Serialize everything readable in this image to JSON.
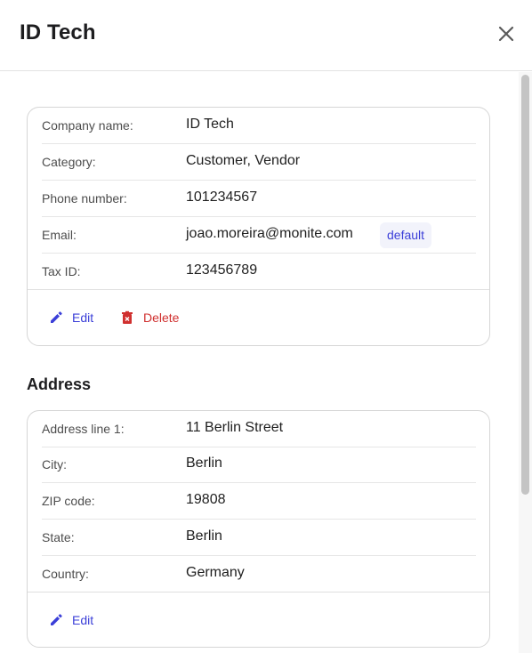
{
  "header": {
    "title": "ID Tech",
    "close_icon": "close-icon"
  },
  "company_card": {
    "fields": [
      {
        "label": "Company name:",
        "value": "ID Tech"
      },
      {
        "label": "Category:",
        "value": "Customer, Vendor"
      },
      {
        "label": "Phone number:",
        "value": "101234567"
      },
      {
        "label": "Email:",
        "value": "joao.moreira@monite.com",
        "badge": "default"
      },
      {
        "label": "Tax ID:",
        "value": "123456789"
      }
    ],
    "edit_label": "Edit",
    "delete_label": "Delete"
  },
  "address_section": {
    "title": "Address",
    "fields": [
      {
        "label": "Address line 1:",
        "value": "11 Berlin Street"
      },
      {
        "label": "City:",
        "value": "Berlin"
      },
      {
        "label": "ZIP code:",
        "value": "19808"
      },
      {
        "label": "State:",
        "value": "Berlin"
      },
      {
        "label": "Country:",
        "value": "Germany"
      }
    ],
    "edit_label": "Edit"
  },
  "colors": {
    "accent": "#3b3fd8",
    "danger": "#d0302f",
    "badge_bg": "#f2f3fb"
  }
}
